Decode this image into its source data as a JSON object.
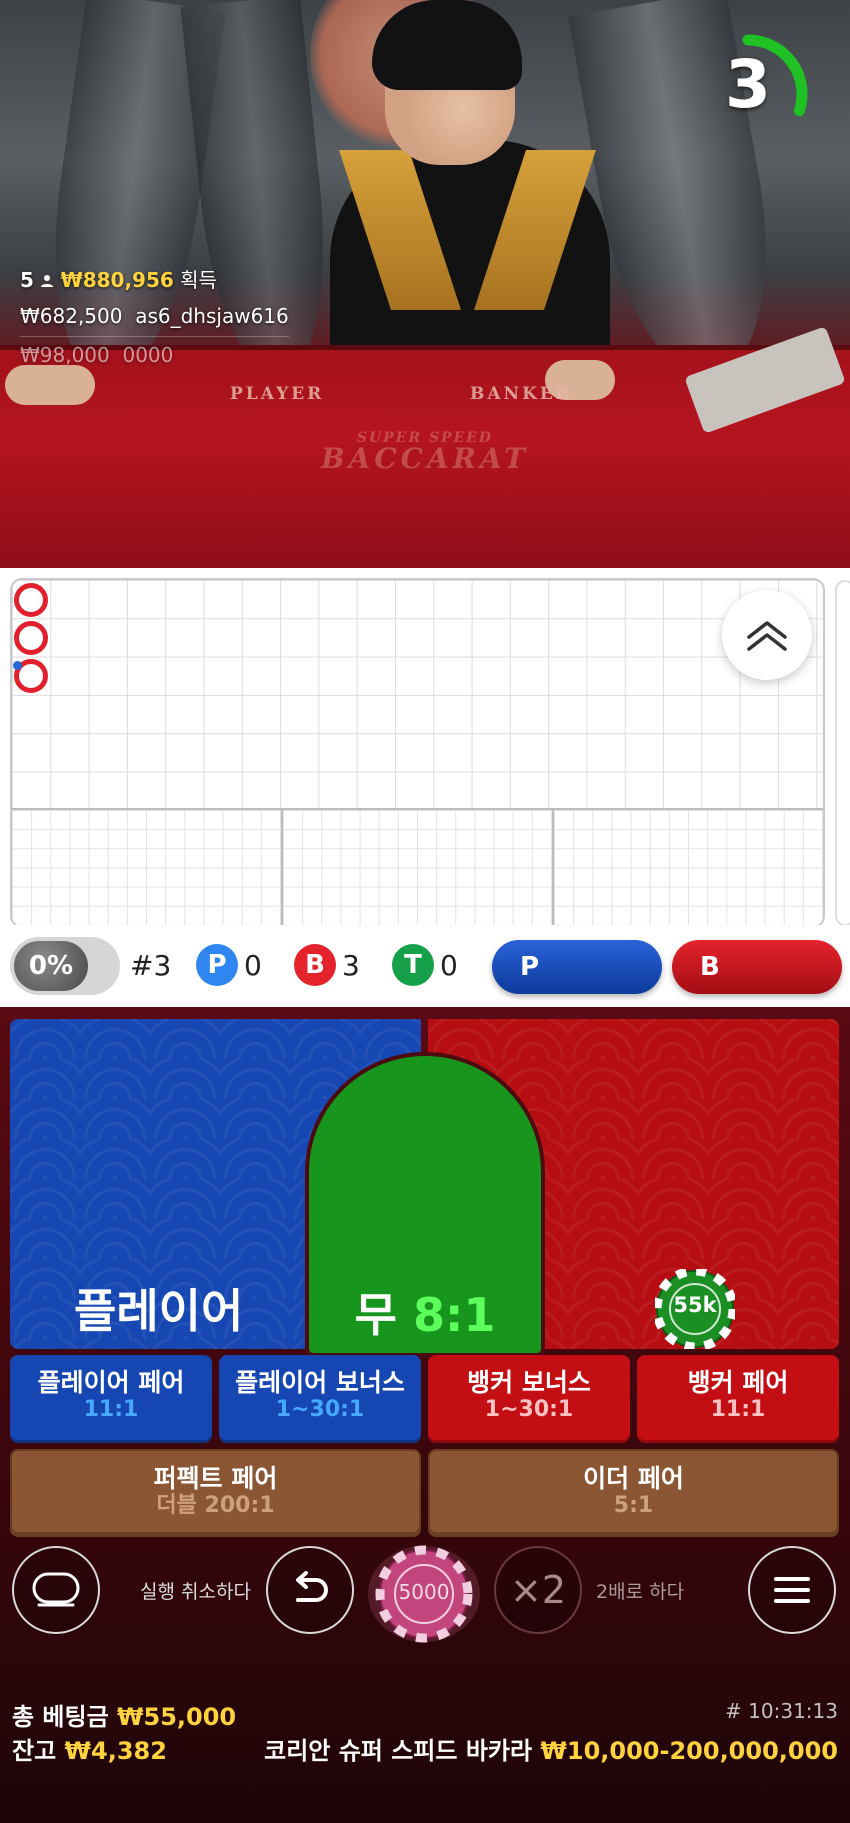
{
  "video": {
    "timer": "3",
    "timer_progress": 0.3,
    "felt_player": "PLAYER",
    "felt_banker": "BANKER",
    "felt_logo_top": "SUPER SPEED",
    "felt_logo_main": "BACCARAT",
    "winners": {
      "count": "5",
      "total": "₩880,956",
      "total_suffix": "획득",
      "rows": [
        {
          "amount": "₩682,500",
          "user": "as6_dhsjaw616"
        },
        {
          "amount": "₩98,000",
          "user": "0000"
        }
      ]
    }
  },
  "roadmap": {
    "collapse_icon": "double-chevron-up-icon"
  },
  "stats": {
    "percent": "0%",
    "round": "#3",
    "player_letter": "P",
    "player_count": "0",
    "banker_letter": "B",
    "banker_count": "3",
    "tie_letter": "T",
    "tie_count": "0",
    "predict_player": "P",
    "predict_banker": "B"
  },
  "bets": {
    "player_label": "플레이어",
    "tie_label": "무",
    "tie_odds": "8:1",
    "banker_chip": "55k",
    "player_pair": {
      "title": "플레이어 페어",
      "odds": "11:1"
    },
    "player_bonus": {
      "title": "플레이어 보너스",
      "odds": "1~30:1"
    },
    "banker_bonus": {
      "title": "뱅커 보너스",
      "odds": "1~30:1"
    },
    "banker_pair": {
      "title": "뱅커 페어",
      "odds": "11:1"
    },
    "perfect_pair": {
      "title": "퍼펙트 페어",
      "odds": "더블 200:1"
    },
    "either_pair": {
      "title": "이더 페어",
      "odds": "5:1"
    }
  },
  "controls": {
    "undo_label": "실행 취소하다",
    "chip_value": "5000",
    "double_symbol": "×2",
    "double_label": "2배로 하다"
  },
  "footer": {
    "total_bet_label": "총 베팅금",
    "total_bet": "₩55,000",
    "balance_label": "잔고",
    "balance": "₩4,382",
    "round_id": "# 10:31:13",
    "table_name": "코리안 슈퍼 스피드 바카라",
    "limits": "₩10,000-200,000,000"
  },
  "colors": {
    "player_blue": "#1647b3",
    "banker_red": "#b60e12",
    "tie_green": "#17951d",
    "gold": "#ffd33d"
  }
}
